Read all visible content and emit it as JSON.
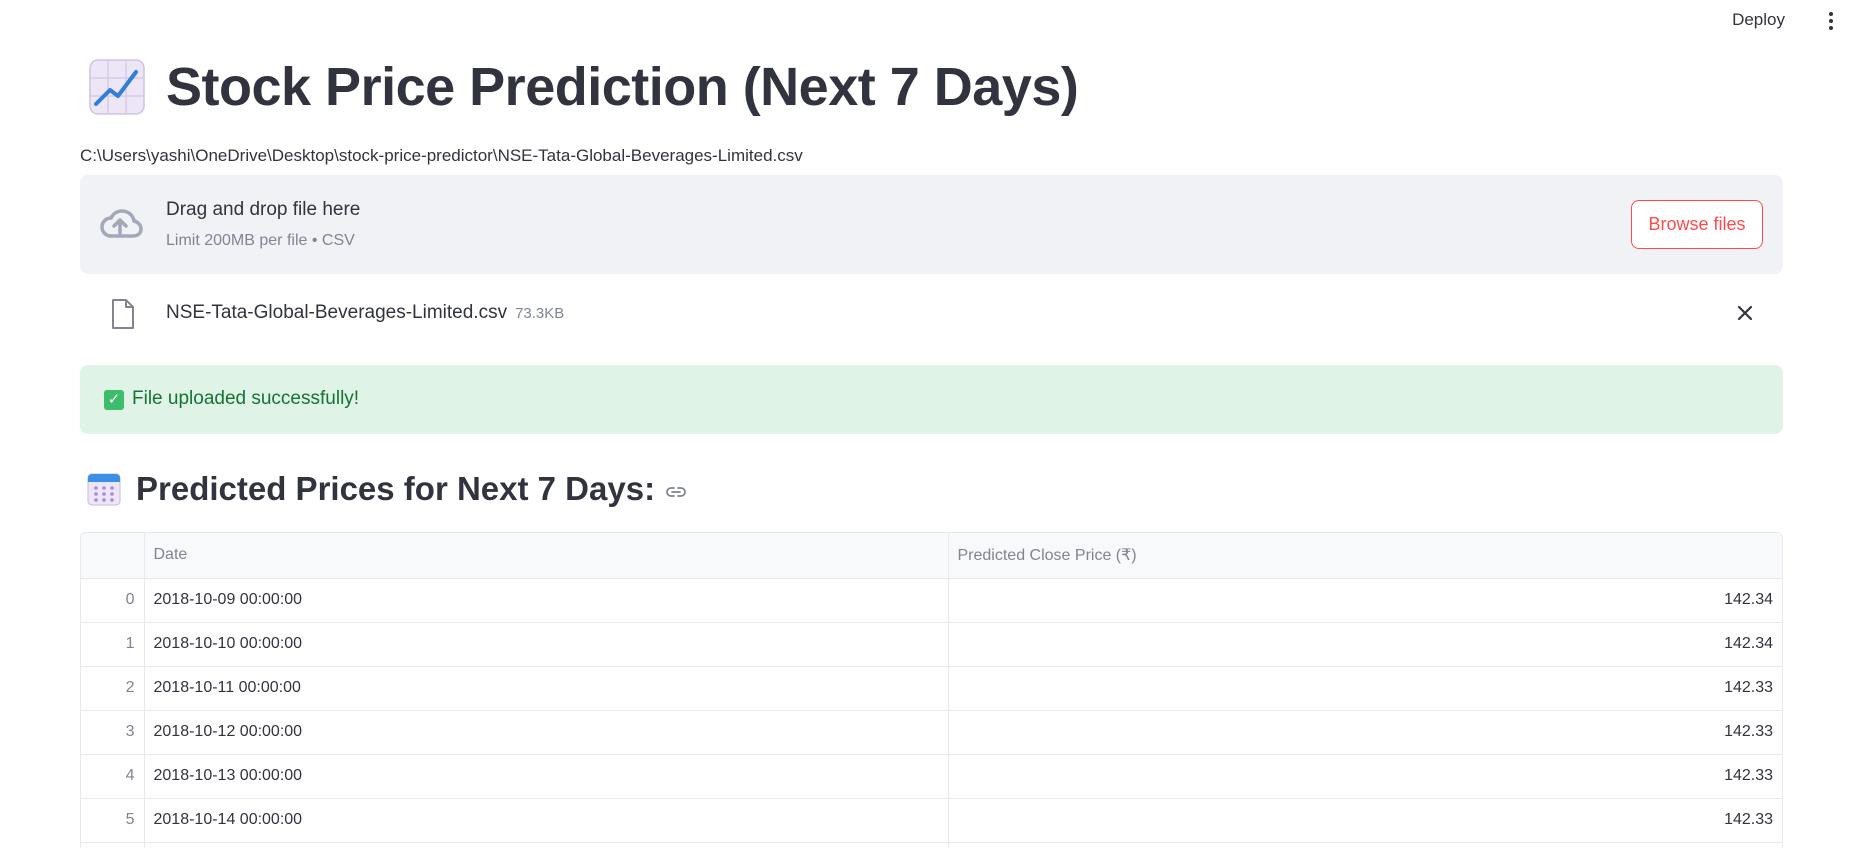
{
  "header": {
    "deploy_label": "Deploy"
  },
  "page": {
    "title_icon": "chart-increasing-icon",
    "title": "Stock Price Prediction (Next 7 Days)"
  },
  "file_path": "C:\\Users\\yashi\\OneDrive\\Desktop\\stock-price-predictor\\NSE-Tata-Global-Beverages-Limited.csv",
  "uploader": {
    "drop_label": "Drag and drop file here",
    "limit_label": "Limit 200MB per file • CSV",
    "browse_label": "Browse files",
    "file": {
      "name": "NSE-Tata-Global-Beverages-Limited.csv",
      "size": "73.3KB"
    }
  },
  "status": {
    "message": "File uploaded successfully!",
    "check_glyph": "✓"
  },
  "predictions": {
    "heading": "Predicted Prices for Next 7 Days:",
    "columns": [
      "",
      "Date",
      "Predicted Close Price (₹)"
    ],
    "rows": [
      {
        "index": "0",
        "date": "2018-10-09 00:00:00",
        "price": "142.34"
      },
      {
        "index": "1",
        "date": "2018-10-10 00:00:00",
        "price": "142.34"
      },
      {
        "index": "2",
        "date": "2018-10-11 00:00:00",
        "price": "142.33"
      },
      {
        "index": "3",
        "date": "2018-10-12 00:00:00",
        "price": "142.33"
      },
      {
        "index": "4",
        "date": "2018-10-13 00:00:00",
        "price": "142.33"
      },
      {
        "index": "5",
        "date": "2018-10-14 00:00:00",
        "price": "142.33"
      },
      {
        "index": "6",
        "date": "",
        "price": ""
      }
    ]
  },
  "colors": {
    "primary": "#ff4b4b",
    "success_bg": "#dff4e7",
    "success_text": "#177233",
    "dropzone_bg": "#f0f2f6"
  }
}
